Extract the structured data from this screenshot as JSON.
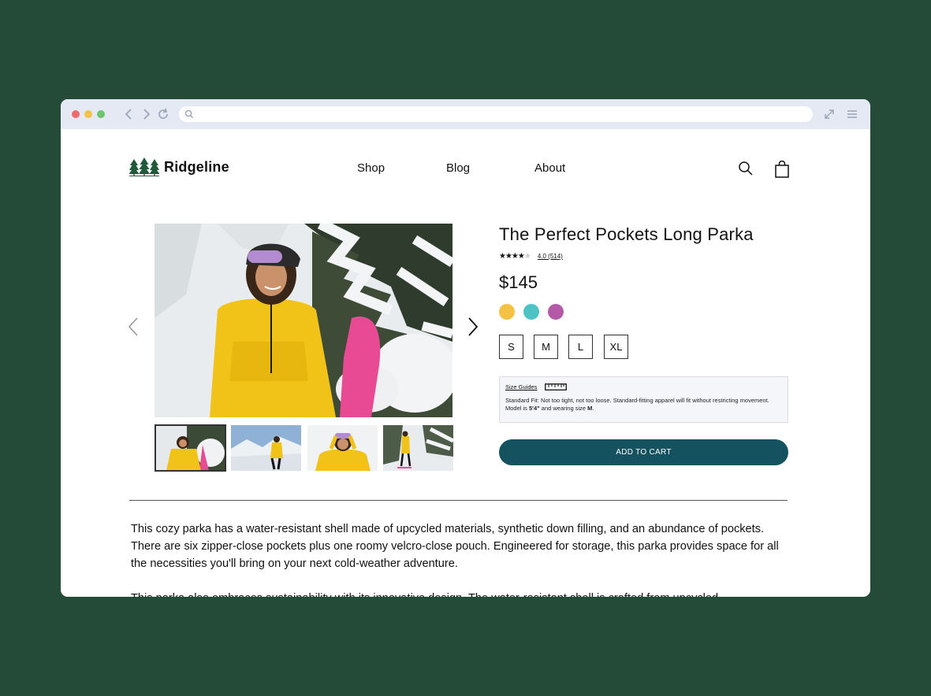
{
  "brand": {
    "name": "Ridgeline"
  },
  "nav": {
    "shop": "Shop",
    "blog": "Blog",
    "about": "About"
  },
  "product": {
    "title": "The Perfect Pockets Long Parka",
    "rating": 4.0,
    "rating_label": "4.0 (514)",
    "price": "$145",
    "colors": [
      "#f6c244",
      "#4ec3c4",
      "#b458a8"
    ],
    "sizes": [
      "S",
      "M",
      "L",
      "XL"
    ],
    "size_guide_label": "Size Guides",
    "fit_prefix": "Standard Fit: Not too tight, not too loose. Standard-fitting apparel will fit without restricting movement. Model is ",
    "fit_height": "5'4\"",
    "fit_mid": " and wearing size ",
    "fit_size": "M",
    "fit_end": ".",
    "add_to_cart": "ADD TO CART"
  },
  "description": {
    "p1": "This cozy parka has a water-resistant shell made of upcycled materials, synthetic down filling, and an abundance of pockets. There are six zipper-close pockets plus one roomy velcro-close pouch. Engineered for storage, this parka provides space for all the necessities you'll bring on your next cold-weather adventure.",
    "p2": "This parka also embraces sustainability with its innovative design. The water-resistant shell is crafted from upcycled"
  },
  "icons": {
    "back": "chevron-left-icon",
    "forward": "chevron-right-icon",
    "reload": "reload-icon",
    "search": "search-icon",
    "bag": "shopping-bag-icon",
    "expand": "expand-icon",
    "menu": "menu-icon",
    "ruler": "ruler-icon"
  },
  "theme": {
    "accent": "#14525f",
    "background": "#234b38",
    "chrome": "#e4e9f4"
  }
}
